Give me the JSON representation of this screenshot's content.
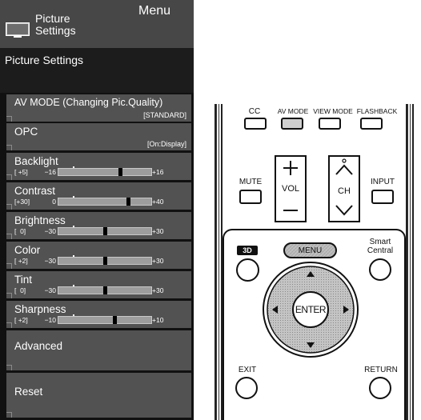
{
  "menu": {
    "header_title": "Picture Settings",
    "header_tag": "Menu",
    "section_title": "Picture Settings",
    "items": [
      {
        "label": "AV MODE (Changing Pic.Quality)",
        "value": "[STANDARD]"
      },
      {
        "label": "OPC",
        "value": "[On:Display]"
      },
      {
        "label": "Backlight",
        "current": "[ +5]",
        "min": "−16",
        "max": "+16",
        "level": 0.66
      },
      {
        "label": "Contrast",
        "current": "[+30]",
        "min": "0",
        "max": "+40",
        "level": 0.75
      },
      {
        "label": "Brightness",
        "current": "[  0]",
        "min": "−30",
        "max": "+30",
        "level": 0.5
      },
      {
        "label": "Color",
        "current": "[ +2]",
        "min": "−30",
        "max": "+30",
        "level": 0.5
      },
      {
        "label": "Tint",
        "current": "[  0]",
        "min": "−30",
        "max": "+30",
        "level": 0.5
      },
      {
        "label": "Sharpness",
        "current": "[ +2]",
        "min": "−10",
        "max": "+10",
        "level": 0.6
      },
      {
        "label": "Advanced"
      },
      {
        "label": "Reset"
      }
    ]
  },
  "remote": {
    "cc": "CC",
    "av_mode": "AV MODE",
    "view_mode": "VIEW MODE",
    "flashback": "FLASHBACK",
    "mute": "MUTE",
    "vol": "VOL",
    "ch": "CH",
    "input": "INPUT",
    "three_d": "3D",
    "menu": "MENU",
    "smart_central_1": "Smart",
    "smart_central_2": "Central",
    "enter": "ENTER",
    "exit": "EXIT",
    "return": "RETURN"
  }
}
